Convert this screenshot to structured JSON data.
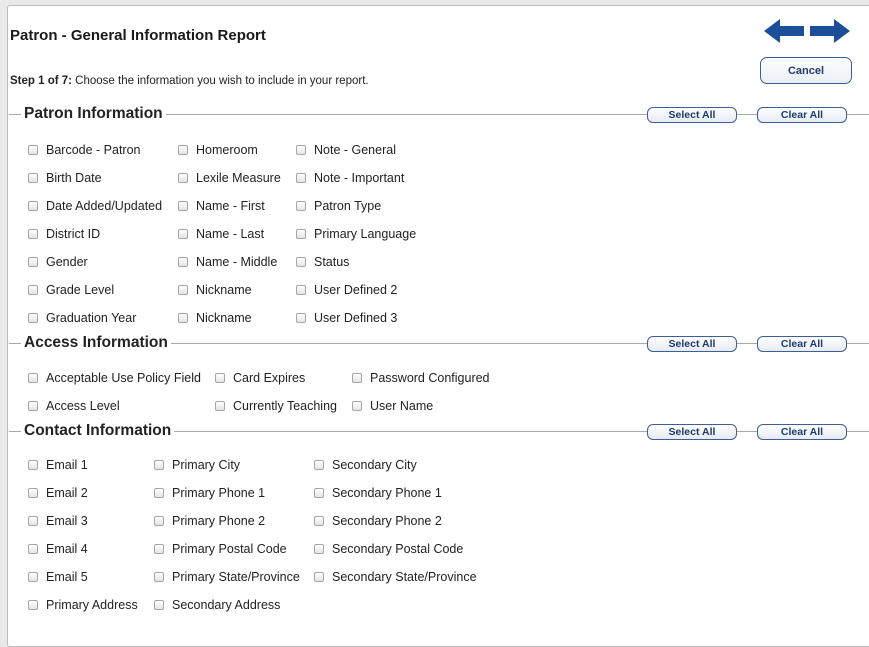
{
  "header": {
    "title": "Patron - General Information Report",
    "cancel_label": "Cancel",
    "step_bold": "Step 1 of 7:",
    "step_text": " Choose the information you wish to include in your report."
  },
  "select_all_label": "Select All",
  "clear_all_label": "Clear All",
  "colors": {
    "accent": "#1d4e9a",
    "button_border": "#3d5f93"
  },
  "sections": [
    {
      "title": "Patron Information",
      "columns": [
        [
          "Barcode - Patron",
          "Birth Date",
          "Date Added/Updated",
          "District ID",
          "Gender",
          "Grade Level",
          "Graduation Year"
        ],
        [
          "Homeroom",
          "Lexile Measure",
          "Name - First",
          "Name - Last",
          "Name - Middle",
          "Nickname",
          "Nickname"
        ],
        [
          "Note - General",
          "Note - Important",
          "Patron Type",
          "Primary Language",
          "Status",
          "User Defined 2",
          "User Defined 3"
        ]
      ]
    },
    {
      "title": "Access Information",
      "columns": [
        [
          "Acceptable Use Policy Field",
          "Access Level"
        ],
        [
          "Card Expires",
          "Currently Teaching"
        ],
        [
          "Password Configured",
          "User Name"
        ]
      ]
    },
    {
      "title": "Contact Information",
      "columns": [
        [
          "Email 1",
          "Email 2",
          "Email 3",
          "Email 4",
          "Email 5",
          "Primary Address"
        ],
        [
          "Primary City",
          "Primary Phone 1",
          "Primary Phone 2",
          "Primary Postal Code",
          "Primary State/Province",
          "Secondary Address"
        ],
        [
          "Secondary City",
          "Secondary Phone 1",
          "Secondary Phone 2",
          "Secondary Postal Code",
          "Secondary State/Province"
        ]
      ]
    }
  ]
}
